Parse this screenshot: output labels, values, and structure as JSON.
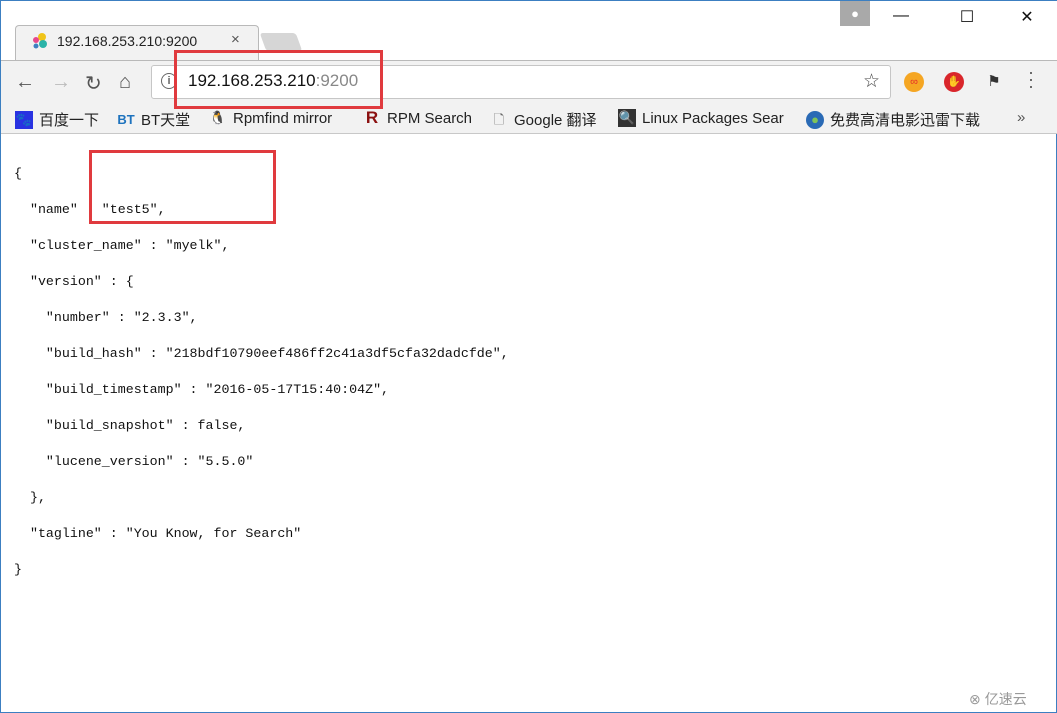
{
  "tab": {
    "title": "192.168.253.210:9200",
    "close": "×"
  },
  "window": {
    "minimize": "—",
    "maximize": "☐",
    "close": "✕"
  },
  "address": {
    "host": "192.168.253.210",
    "port": ":9200"
  },
  "bookmarks": [
    {
      "label": "百度一下",
      "icon": "baidu-paw-icon"
    },
    {
      "label": "BT天堂",
      "icon": "bt-icon"
    },
    {
      "label": "Rpmfind mirror",
      "icon": "tux-icon"
    },
    {
      "label": "RPM Search",
      "icon": "r-icon"
    },
    {
      "label": "Google 翻译",
      "icon": "page-icon"
    },
    {
      "label": "Linux Packages Sear",
      "icon": "magnifier-icon"
    },
    {
      "label": "免费高清电影迅雷下载",
      "icon": "globe-icon"
    }
  ],
  "bookmarks_more": "»",
  "json_lines": [
    "{",
    "  \"name\" : \"test5\",",
    "  \"cluster_name\" : \"myelk\",",
    "  \"version\" : {",
    "    \"number\" : \"2.3.3\",",
    "    \"build_hash\" : \"218bdf10790eef486ff2c41a3df5cfa32dadcfde\",",
    "    \"build_timestamp\" : \"2016-05-17T15:40:04Z\",",
    "    \"build_snapshot\" : false,",
    "    \"lucene_version\" : \"5.5.0\"",
    "  },",
    "  \"tagline\" : \"You Know, for Search\"",
    "}"
  ],
  "watermark": "亿速云",
  "colors": {
    "highlight": "#e03a3e"
  }
}
